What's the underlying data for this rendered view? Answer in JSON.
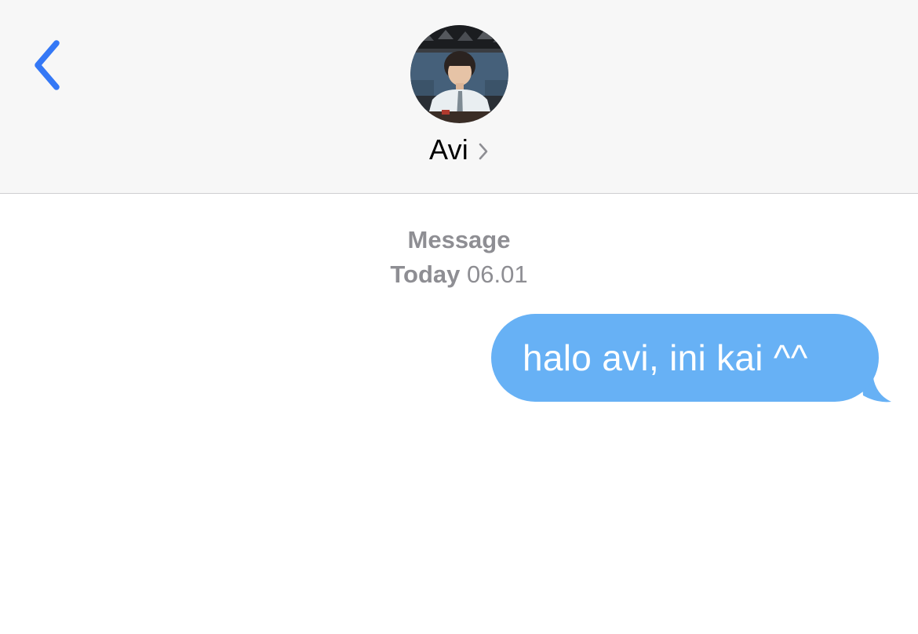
{
  "header": {
    "contact_name": "Avi",
    "back_icon": "chevron-left-icon",
    "name_chevron_icon": "chevron-right-icon",
    "accent_color": "#3478f6"
  },
  "thread": {
    "service_label": "Message",
    "day_label": "Today",
    "time": "06.01"
  },
  "messages": [
    {
      "direction": "outgoing",
      "text": "halo avi, ini kai ^^",
      "bubble_color": "#67b1f5"
    }
  ]
}
